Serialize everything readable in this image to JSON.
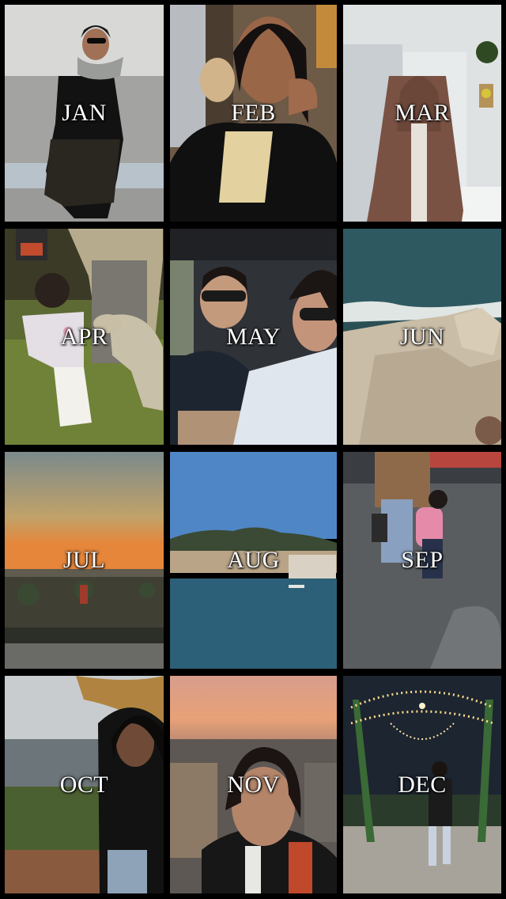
{
  "collage": {
    "tiles": [
      {
        "month": "JAN",
        "scene": "woman-standing-wall"
      },
      {
        "month": "FEB",
        "scene": "woman-smiling-restaurant"
      },
      {
        "month": "MAR",
        "scene": "woman-hijab-room"
      },
      {
        "month": "APR",
        "scene": "child-feeding-goat"
      },
      {
        "month": "MAY",
        "scene": "car-selfie"
      },
      {
        "month": "JUN",
        "scene": "sea-rocks"
      },
      {
        "month": "JUL",
        "scene": "sunset-harbor"
      },
      {
        "month": "AUG",
        "scene": "hill-town-waterfront"
      },
      {
        "month": "SEP",
        "scene": "walking-child-backpack"
      },
      {
        "month": "OCT",
        "scene": "woman-autumn-hill"
      },
      {
        "month": "NOV",
        "scene": "selfie-paris-sunset"
      },
      {
        "month": "DEC",
        "scene": "christmas-lights-gazebo"
      }
    ]
  }
}
